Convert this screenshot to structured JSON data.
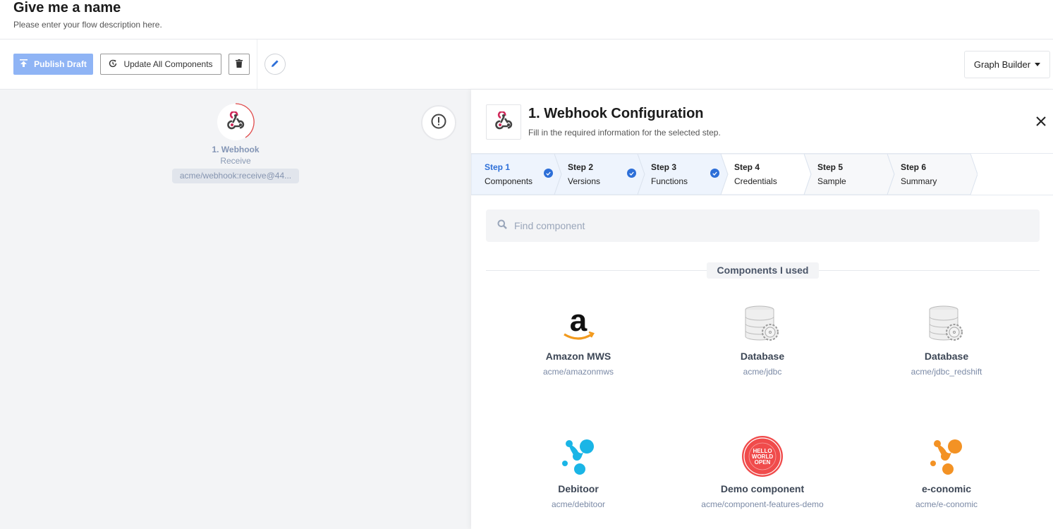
{
  "header": {
    "title": "Give me a name",
    "description": "Please enter your flow description here."
  },
  "toolbar": {
    "publish_label": "Publish Draft",
    "update_label": "Update All Components",
    "view_mode_label": "Graph Builder"
  },
  "canvas": {
    "node": {
      "title": "1. Webhook",
      "subtitle": "Receive",
      "badge": "acme/webhook:receive@44..."
    }
  },
  "panel": {
    "title": "1. Webhook Configuration",
    "subtitle": "Fill in the required information for the selected step.",
    "close_label": "×",
    "steps": [
      {
        "num": "Step 1",
        "label": "Components",
        "state": "done-active"
      },
      {
        "num": "Step 2",
        "label": "Versions",
        "state": "done"
      },
      {
        "num": "Step 3",
        "label": "Functions",
        "state": "done"
      },
      {
        "num": "Step 4",
        "label": "Credentials",
        "state": "current"
      },
      {
        "num": "Step 5",
        "label": "Sample",
        "state": "pending"
      },
      {
        "num": "Step 6",
        "label": "Summary",
        "state": "pending"
      }
    ],
    "search": {
      "placeholder": "Find component",
      "value": ""
    },
    "section_label": "Components I used",
    "components": [
      {
        "name": "Amazon MWS",
        "id": "acme/amazonmws",
        "icon": "amazon-logo"
      },
      {
        "name": "Database",
        "id": "acme/jdbc",
        "icon": "database-gear-logo"
      },
      {
        "name": "Database",
        "id": "acme/jdbc_redshift",
        "icon": "database-gear-logo"
      },
      {
        "name": "Debitoor",
        "id": "acme/debitoor",
        "icon": "debitoor-logo"
      },
      {
        "name": "Demo component",
        "id": "acme/component-features-demo",
        "icon": "hello-world-open-logo"
      },
      {
        "name": "e-conomic",
        "id": "acme/e-conomic",
        "icon": "e-conomic-logo"
      }
    ]
  },
  "colors": {
    "accent": "#2d6fd8",
    "publish_disabled": "#8fb4f5",
    "canvas_bg": "#f3f4f6",
    "step_done_bg": "#eef4fd",
    "step_pending_bg": "#f7f8fa",
    "webhook_red": "#d0295a",
    "debitoor_blue": "#1ab5e6",
    "economic_orange": "#f39224"
  }
}
